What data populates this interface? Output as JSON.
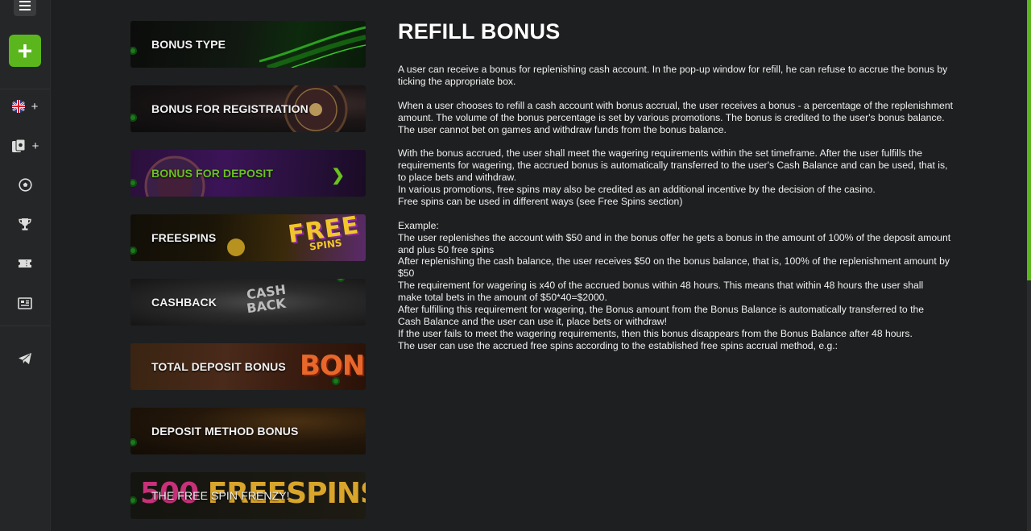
{
  "sidebar": {
    "items": [
      {
        "icon": "uk-flag-icon",
        "plus": "+"
      },
      {
        "icon": "cards-icon",
        "plus": "+"
      },
      {
        "icon": "soccer-ball-icon"
      },
      {
        "icon": "trophy-icon"
      },
      {
        "icon": "ticket-icon"
      },
      {
        "icon": "news-icon"
      },
      {
        "icon": "telegram-icon"
      }
    ],
    "accent_color": "#5bb61d"
  },
  "menu": {
    "items": [
      {
        "label": "BONUS TYPE"
      },
      {
        "label": "BONUS FOR REGISTRATION"
      },
      {
        "label": "BONUS FOR DEPOSIT",
        "active": true
      },
      {
        "label": "FREESPINS"
      },
      {
        "label": "CASHBACK"
      },
      {
        "label": "TOTAL DEPOSIT BONUS"
      },
      {
        "label": "DEPOSIT METHOD BONUS"
      },
      {
        "label": "THE FREE SPIN FRENZY!"
      }
    ],
    "active_color": "#6ac21e"
  },
  "card_art_text": {
    "freespins_big": "FREE",
    "freespins_small": "SPINS",
    "cashback_line1": "CASH",
    "cashback_line2": "BACK",
    "total_deposit": "BONU",
    "frenzy_number": "500",
    "frenzy_free": "FREE",
    "frenzy_spins": "SPINS"
  },
  "article": {
    "title": "REFILL BONUS",
    "paragraphs": [
      "A user can receive a bonus for replenishing cash account. In the pop-up window for refill, he can refuse to accrue the bonus by\nticking the appropriate box.",
      "When a user chooses to refill a cash account with bonus accrual, the user receives a bonus - a percentage of the replenishment\namount. The volume of the bonus percentage is set by various promotions. The bonus is credited to the user's bonus balance.\nThe user cannot bet on games and withdraw funds from the bonus balance.",
      "With the bonus accrued, the user shall meet the wagering requirements within the set timeframe. After the user fulfills the\nrequirements for wagering, the accrued bonus is automatically transferred to the user's Cash Balance and can be used, that is,\nto place bets and withdraw.\nIn various promotions, free spins may also be credited as an additional incentive by the decision of the casino.\nFree spins can be used in different ways (see Free Spins section)",
      "Example:\nThe user replenishes the account with $50 and in the bonus offer he gets a bonus in the amount of 100% of the deposit amount\nand plus 50 free spins\nAfter replenishing the cash balance, the user receives $50 on the bonus balance, that is, 100% of the replenishment amount by\n$50\nThe requirement for wagering is x40 of the accrued bonus within 48 hours. This means that within 48 hours the user shall\nmake total bets in the amount of $50*40=$2000.\nAfter fulfilling this requirement for wagering, the Bonus amount from the Bonus Balance is automatically transferred to the\nCash Balance and the user can use it, place bets or withdraw!\nIf the user fails to meet the wagering requirements, then this bonus disappears from the Bonus Balance after 48 hours.\nThe user can use the accrued free spins according to the established free spins accrual method, e.g.:"
    ]
  }
}
